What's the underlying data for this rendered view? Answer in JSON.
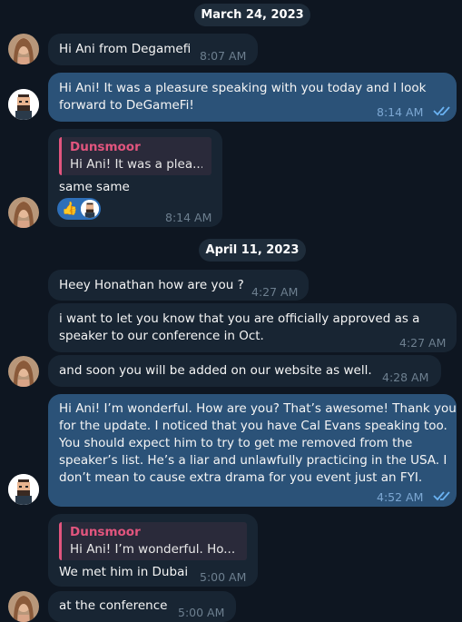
{
  "dates": [
    "March 24, 2023",
    "April 11, 2023"
  ],
  "messages": [
    {
      "text": "Hi Ani from Degamefi",
      "time": "8:07 AM"
    },
    {
      "line1": "Hi Ani! It was a pleasure speaking with you today and I look",
      "line2": "forward to DeGameFi!",
      "time": "8:14 AM"
    },
    {
      "reply_name": "Dunsmoor",
      "reply_text": "Hi Ani! It was a plea...",
      "text": "same same",
      "time": "8:14 AM",
      "reaction_emoji": "👍"
    },
    {
      "text": "Heey Honathan how are you ?",
      "time": "4:27 AM"
    },
    {
      "line1": "i want to let you know that you are officially approved as a",
      "line2": "speaker to our conference in Oct.",
      "time": "4:27 AM"
    },
    {
      "text": "and soon you will be added on our website as well.",
      "time": "4:28 AM"
    },
    {
      "lines": [
        "Hi Ani! I’m wonderful. How are you? That’s awesome! Thank you",
        "for the update. I noticed that you have Cal Evans speaking too.",
        "You should expect him to try to get me removed from the",
        "speaker’s list. He’s a liar and unlawfully practicing in the USA. I",
        "don’t mean to cause extra drama for you event just an FYI."
      ],
      "time": "4:52 AM"
    },
    {
      "reply_name": "Dunsmoor",
      "reply_text": "Hi Ani! I’m wonderful. Ho...",
      "text": "We met him in Dubai",
      "time": "5:00 AM"
    },
    {
      "text": "at the conference",
      "time": "5:00 AM"
    }
  ],
  "colors": {
    "background": "#0e1621",
    "incoming": "#182533",
    "outgoing": "#2b5278",
    "reply_accent": "#e2557e",
    "check": "#6ab2f2"
  },
  "icons": {
    "read_receipt": "double-check-icon",
    "female_avatar": "avatar-photo",
    "male_avatar": "pixel-avatar"
  }
}
